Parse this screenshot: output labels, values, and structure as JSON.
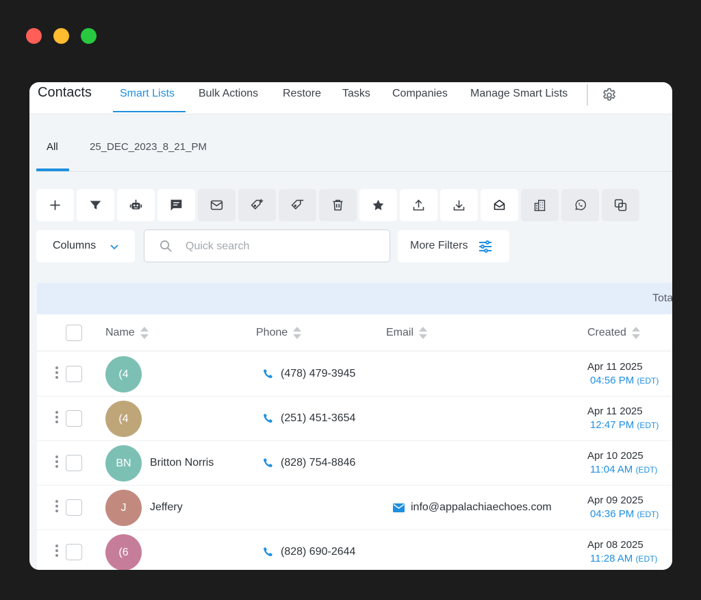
{
  "window_controls": {
    "close_color": "#ff5f57",
    "minimize_color": "#febc2e",
    "maximize_color": "#28c840"
  },
  "header": {
    "title": "Contacts",
    "nav": [
      {
        "label": "Smart Lists",
        "active": true
      },
      {
        "label": "Bulk Actions",
        "active": false
      },
      {
        "label": "Restore",
        "active": false
      },
      {
        "label": "Tasks",
        "active": false
      },
      {
        "label": "Companies",
        "active": false
      },
      {
        "label": "Manage Smart Lists",
        "active": false
      }
    ],
    "settings_icon": "gear-icon"
  },
  "subtabs": [
    {
      "label": "All",
      "active": true
    },
    {
      "label": "25_DEC_2023_8_21_PM",
      "active": false
    }
  ],
  "toolbar": {
    "buttons": [
      {
        "icon": "plus-icon",
        "style": "white"
      },
      {
        "icon": "filter-icon",
        "style": "white"
      },
      {
        "icon": "robot-icon",
        "style": "white"
      },
      {
        "icon": "message-icon",
        "style": "white"
      },
      {
        "icon": "email-icon",
        "style": "gray"
      },
      {
        "icon": "tag-add-icon",
        "style": "gray"
      },
      {
        "icon": "tag-remove-icon",
        "style": "gray"
      },
      {
        "icon": "trash-icon",
        "style": "gray"
      },
      {
        "icon": "star-icon",
        "style": "white"
      },
      {
        "icon": "upload-icon",
        "style": "white"
      },
      {
        "icon": "download-icon",
        "style": "white"
      },
      {
        "icon": "envelope-open-icon",
        "style": "white"
      },
      {
        "icon": "building-icon",
        "style": "gray"
      },
      {
        "icon": "whatsapp-icon",
        "style": "gray"
      },
      {
        "icon": "merge-icon",
        "style": "gray"
      }
    ]
  },
  "filters": {
    "columns_label": "Columns",
    "search_placeholder": "Quick search",
    "more_filters_label": "More Filters"
  },
  "total_label": "Tota",
  "table": {
    "columns": [
      "Name",
      "Phone",
      "Email",
      "Created"
    ],
    "rows": [
      {
        "initials": "(4",
        "avatar_color": "#7cc0b4",
        "name": "",
        "phone": "(478) 479-3945",
        "email": "",
        "date": "Apr 11 2025",
        "time": "04:56 PM",
        "tz": "(EDT)"
      },
      {
        "initials": "(4",
        "avatar_color": "#bfa679",
        "name": "",
        "phone": "(251) 451-3654",
        "email": "",
        "date": "Apr 11 2025",
        "time": "12:47 PM",
        "tz": "(EDT)"
      },
      {
        "initials": "BN",
        "avatar_color": "#7cc0b4",
        "name": "Britton Norris",
        "phone": "(828) 754-8846",
        "email": "",
        "date": "Apr 10 2025",
        "time": "11:04 AM",
        "tz": "(EDT)"
      },
      {
        "initials": "J",
        "avatar_color": "#c28a7e",
        "name": "Jeffery",
        "phone": "",
        "email": "info@appalachiaechoes.com",
        "date": "Apr 09 2025",
        "time": "04:36 PM",
        "tz": "(EDT)"
      },
      {
        "initials": "(6",
        "avatar_color": "#c67d9a",
        "name": "",
        "phone": "(828) 690-2644",
        "email": "",
        "date": "Apr 08 2025",
        "time": "11:28 AM",
        "tz": "(EDT)"
      }
    ]
  },
  "colors": {
    "accent": "#1f8fe0",
    "background": "#1c1c1c"
  }
}
